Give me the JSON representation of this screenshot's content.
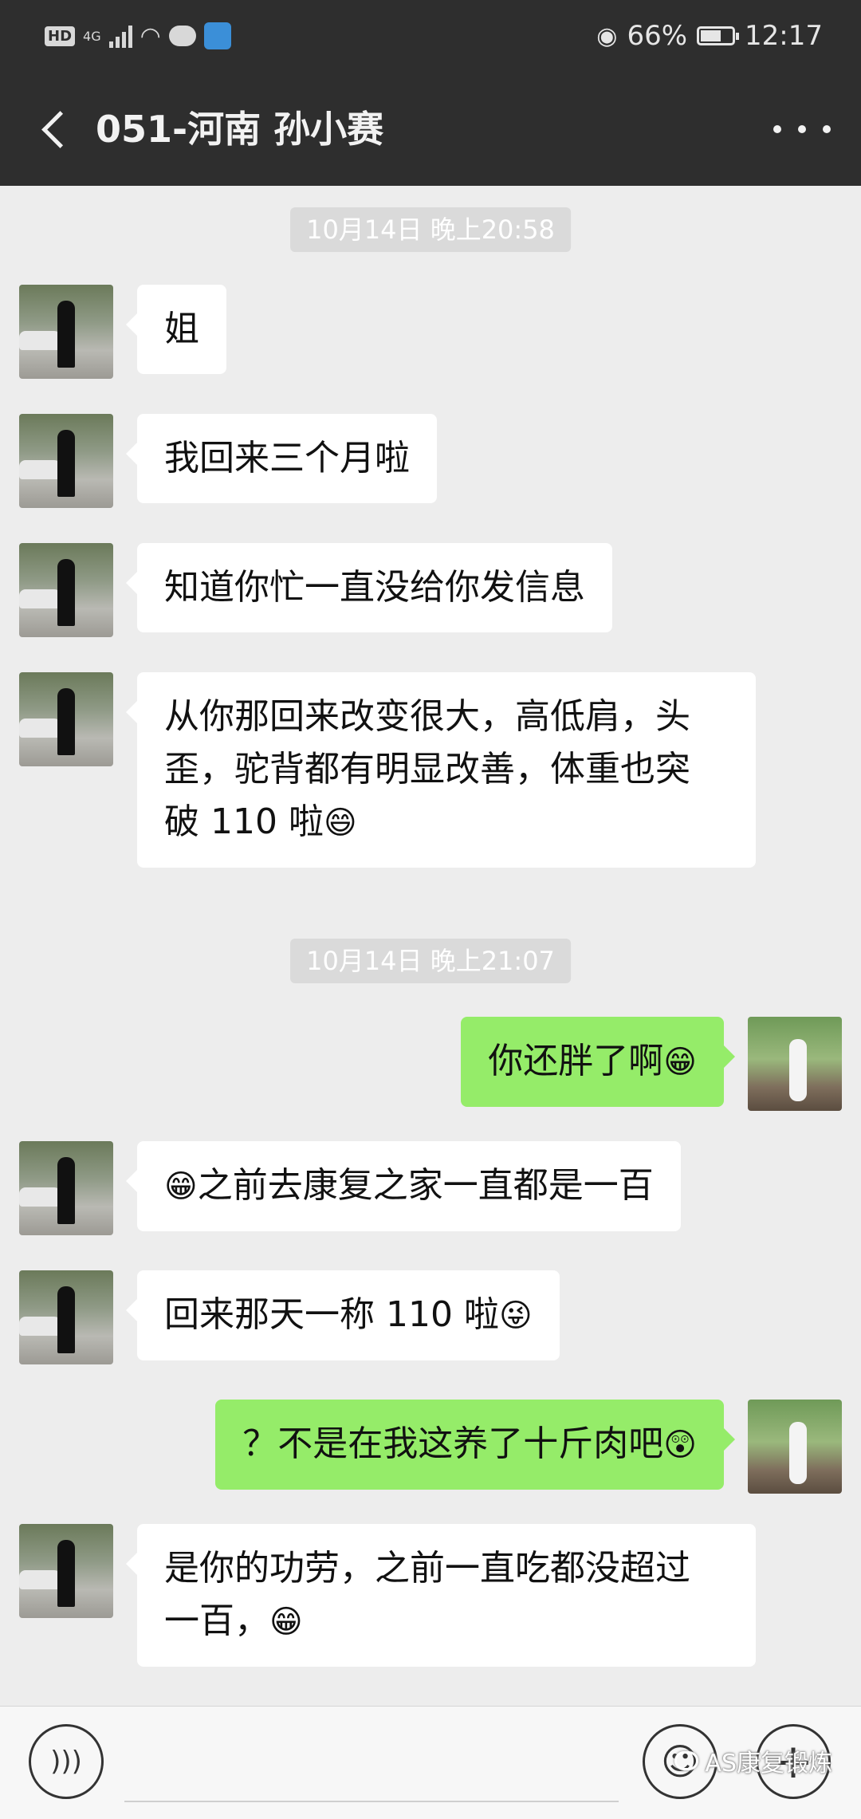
{
  "status_bar": {
    "hd": "HD",
    "network": "4G",
    "battery_percent": "66%",
    "battery_level": 0.66,
    "time": "12:17"
  },
  "header": {
    "title": "051-河南 孙小赛",
    "back_icon": "chevron-left-icon",
    "more_icon": "more-dots-icon"
  },
  "timestamps": [
    "10月14日 晚上20:58",
    "10月14日 晚上21:07"
  ],
  "messages": [
    {
      "side": "left",
      "text": "姐"
    },
    {
      "side": "left",
      "text": "我回来三个月啦"
    },
    {
      "side": "left",
      "text": "知道你忙一直没给你发信息"
    },
    {
      "side": "left",
      "line1": "从你那回来改变很大，高低肩，头",
      "line2": "歪，驼背都有明显改善，体重也突",
      "line3": "破 110 啦",
      "emoji": "😄"
    },
    {
      "side": "right",
      "text": "你还胖了啊",
      "emoji": "😁"
    },
    {
      "side": "left",
      "emoji": "😁",
      "text": "之前去康复之家一直都是一百"
    },
    {
      "side": "left",
      "text": "回来那天一称 110 啦",
      "emoji": "😜"
    },
    {
      "side": "right",
      "text": "？不是在我这养了十斤肉吧",
      "emoji": "😲"
    },
    {
      "side": "left",
      "line1": "是你的功劳，之前一直吃都没超过",
      "line2": "一百，",
      "emoji": "😁"
    }
  ],
  "input_bar": {
    "voice_icon": "voice-icon",
    "emoji_icon": "emoji-icon",
    "plus_icon": "plus-icon"
  },
  "watermark": "AS康复锻炼"
}
